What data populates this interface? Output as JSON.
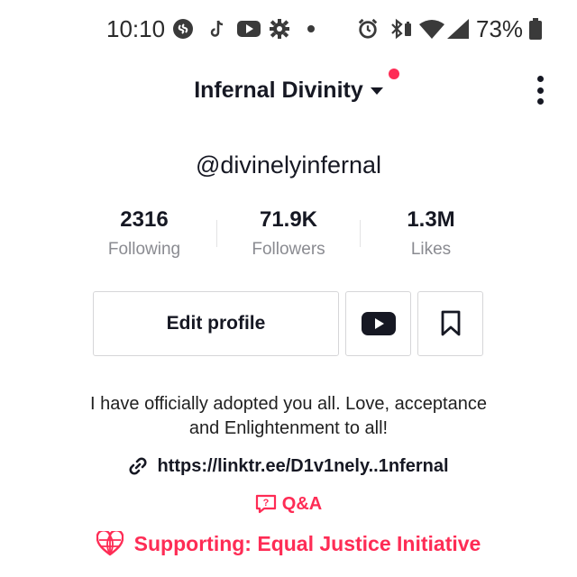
{
  "status_bar": {
    "time": "10:10",
    "battery_percent": "73%",
    "left_icons": [
      "shazam-icon",
      "tiktok-icon",
      "youtube-icon",
      "settings-icon",
      "dot-icon"
    ],
    "right_icons": [
      "alarm-icon",
      "bluetooth-battery-icon",
      "wifi-icon",
      "signal-icon",
      "battery-icon"
    ]
  },
  "header": {
    "title": "Infernal Divinity"
  },
  "profile": {
    "handle": "@divinelyinfernal"
  },
  "stats": [
    {
      "value": "2316",
      "label": "Following"
    },
    {
      "value": "71.9K",
      "label": "Followers"
    },
    {
      "value": "1.3M",
      "label": "Likes"
    }
  ],
  "actions": {
    "edit_label": "Edit profile",
    "youtube_icon": "youtube-icon",
    "bookmark_icon": "bookmark-icon"
  },
  "bio": {
    "line1": "I have officially adopted you all. Love, acceptance",
    "line2": "and Enlightenment to all!",
    "link": "https://linktr.ee/D1v1nely..1nfernal",
    "qa_label": "Q&A",
    "supporting_label": "Supporting: Equal Justice Initiative"
  },
  "colors": {
    "accent": "#fe2c55",
    "text": "#161823",
    "muted": "#8a8b91",
    "border": "#d6d6d8"
  }
}
